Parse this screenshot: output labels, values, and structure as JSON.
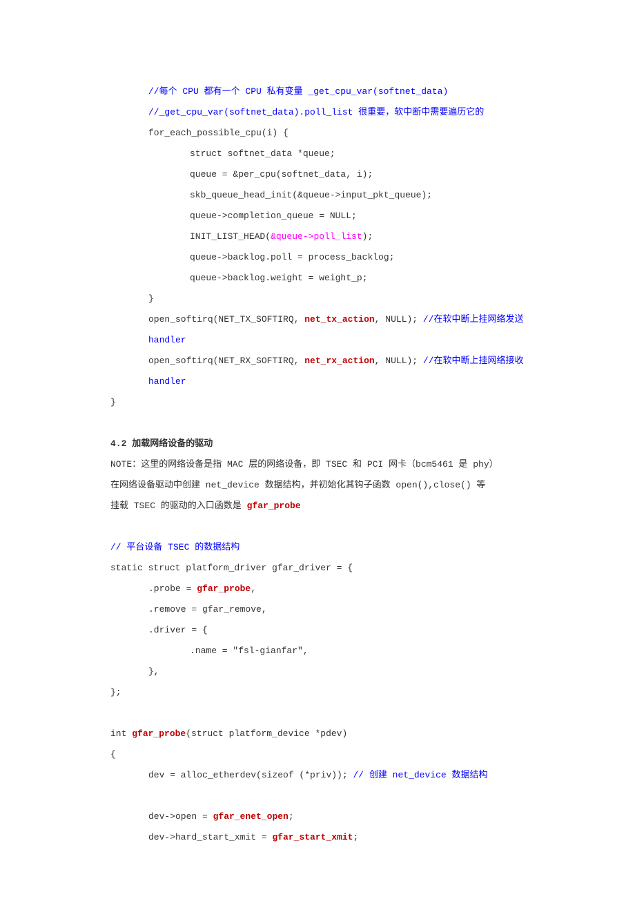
{
  "comment1": "//每个 CPU 都有一个 CPU 私有变量 _get_cpu_var(softnet_data)",
  "comment2": "//_get_cpu_var(softnet_data).poll_list 很重要，软中断中需要遍历它的",
  "c_for": "for_each_possible_cpu(i) {",
  "c_s1": "struct softnet_data *queue;",
  "c_s2": "queue = &per_cpu(softnet_data, i);",
  "c_s3": "skb_queue_head_init(&queue->input_pkt_queue);",
  "c_s4": "queue->completion_queue = NULL;",
  "c_s5_a": " INIT_LIST_HEAD(",
  "c_s5_b": "&queue->poll_list",
  "c_s5_c": ");",
  "c_s6": "queue->backlog.poll = process_backlog;",
  "c_s7": "queue->backlog.weight = weight_p;",
  "c_close": "}",
  "tx_a": "open_softirq(NET_TX_SOFTIRQ, ",
  "tx_b": "net_tx_action",
  "tx_c": ", NULL);  ",
  "tx_d": "//在软中断上挂网络发送 handler",
  "rx_a": "open_softirq(NET_RX_SOFTIRQ, ",
  "rx_b": "net_rx_action",
  "rx_c": ", NULL);  ",
  "rx_d": "//在软中断上挂网络接收 handler",
  "brace_end": "}",
  "s42_heading": "4.2 加载网络设备的驱动",
  "s42_l1": "NOTE：这里的网络设备是指 MAC 层的网络设备，即 TSEC 和 PCI 网卡（bcm5461 是 phy）",
  "s42_l2": "在网络设备驱动中创建 net_device 数据结构，并初始化其钩子函数 open(),close() 等",
  "s42_l3_a": "挂载 TSEC 的驱动的入口函数是  ",
  "s42_l3_b": "gfar_probe",
  "c2_comment": "// 平台设备 TSEC 的数据结构",
  "c2_l1": "static struct platform_driver gfar_driver = {",
  "c2_l2a": ".probe = ",
  "c2_l2b": "gfar_probe",
  "c2_l2c": ",",
  "c2_l3": ".remove = gfar_remove,",
  "c2_l4": ".driver = {",
  "c2_l5": ".name = \"fsl-gianfar\",",
  "c2_l6": "},",
  "c2_l7": "};",
  "c3_sig_a": "int ",
  "c3_sig_b": "gfar_probe",
  "c3_sig_c": "(struct platform_device *pdev)",
  "c3_open": "{",
  "c3_l1a": "dev = alloc_etherdev(sizeof (*priv));  ",
  "c3_l1b": "// 创建 net_device 数据结构",
  "c3_l2a": "dev->open = ",
  "c3_l2b": "gfar_enet_open",
  "c3_l2c": ";",
  "c3_l3a": "dev->hard_start_xmit = ",
  "c3_l3b": "gfar_start_xmit",
  "c3_l3c": ";"
}
